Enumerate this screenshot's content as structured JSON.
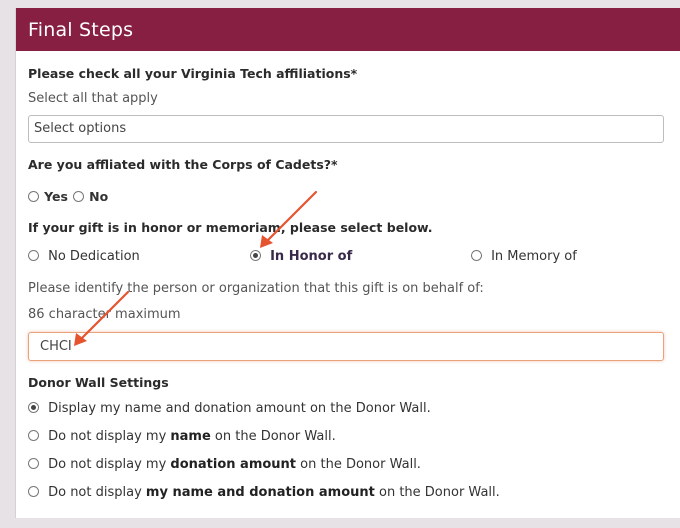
{
  "header": {
    "title": "Final Steps"
  },
  "affiliations": {
    "label": "Please check all your Virginia Tech affiliations*",
    "hint": "Select all that apply",
    "select_placeholder": "Select options"
  },
  "corps": {
    "label": "Are you affliated with the Corps of Cadets?*",
    "options": [
      "Yes",
      "No"
    ]
  },
  "dedication": {
    "label": "If your gift is in honor or memoriam, please select below.",
    "options": [
      "No Dedication",
      "In Honor of",
      "In Memory of"
    ],
    "selected": "In Honor of"
  },
  "behalf": {
    "label": "Please identify the person or organization that this gift is on behalf of:",
    "max_hint": "86 character maximum",
    "value": "CHCI"
  },
  "donor_wall": {
    "title": "Donor Wall Settings",
    "opt1": "Display my name and donation amount on the Donor Wall.",
    "opt2_pre": "Do not display my ",
    "opt2_bold": "name",
    "opt2_post": " on the Donor Wall.",
    "opt3_pre": "Do not display my ",
    "opt3_bold": "donation amount",
    "opt3_post": " on the Donor Wall.",
    "opt4_pre": "Do not display ",
    "opt4_bold": "my name and donation amount",
    "opt4_post": " on the Donor Wall."
  },
  "colors": {
    "header_bg": "#861f41",
    "arrow": "#e5532f"
  }
}
